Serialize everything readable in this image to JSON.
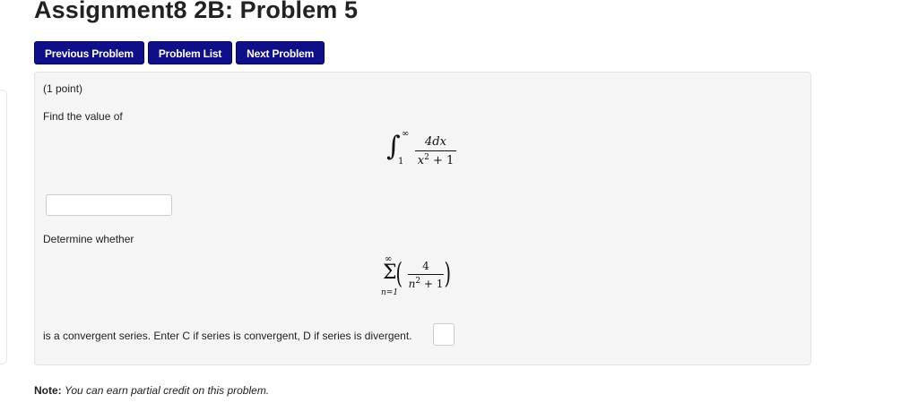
{
  "header": {
    "title": "Assignment8 2B: Problem 5"
  },
  "nav": {
    "previous_label": "Previous Problem",
    "list_label": "Problem List",
    "next_label": "Next Problem",
    "button_color": "#0f0f8a"
  },
  "problem": {
    "points": "(1 point)",
    "prompt_integral": "Find the value of",
    "integral": {
      "sign": "∫",
      "upper": "∞",
      "lower": "1",
      "numerator": "4dx",
      "denominator_base": "x",
      "denominator_exp": "2",
      "denominator_rest": " + 1"
    },
    "answer1_value": "",
    "prompt_series": "Determine whether",
    "series": {
      "sign": "Σ",
      "upper": "∞",
      "lower": "n=1",
      "open_paren": "(",
      "close_paren": ")",
      "numerator": "4",
      "denominator_base": "n",
      "denominator_exp": "2",
      "denominator_rest": " + 1"
    },
    "series_question": "is a convergent series. Enter C if series is convergent, D if series is divergent.",
    "answer2_value": ""
  },
  "footer": {
    "note_label": "Note:",
    "note_text": "You can earn partial credit on this problem."
  }
}
